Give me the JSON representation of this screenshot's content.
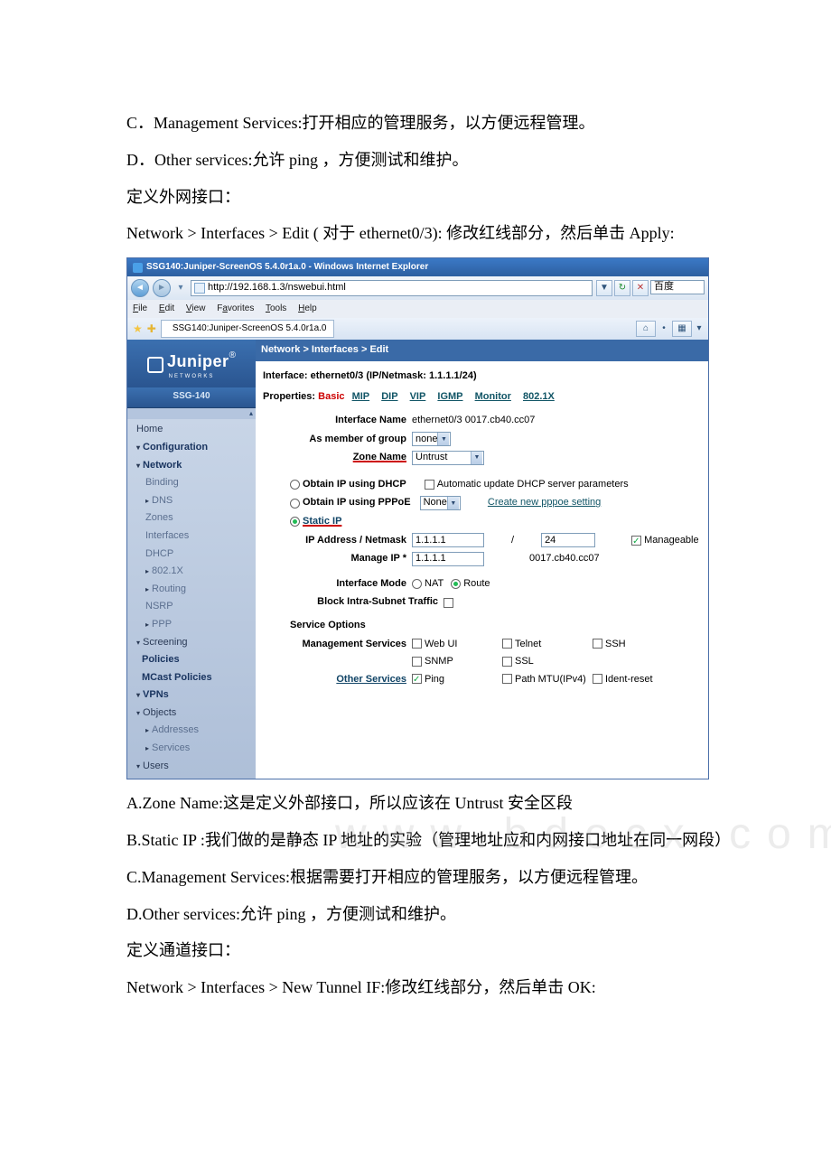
{
  "doc": {
    "pC": "C．Management Services:打开相应的管理服务，以方便远程管理。",
    "pD": "D．Other services:允许 ping ，方便测试和维护。",
    "p3": "定义外网接口：",
    "p4": "Network > Interfaces > Edit ( 对于 ethernet0/3): 修改红线部分，然后单击 Apply:",
    "pA2": "A.Zone Name:这是定义外部接口，所以应该在 Untrust 安全区段",
    "pB2": "B.Static IP :我们做的是静态 IP 地址的实验（管理地址应和内网接口地址在同一网段）",
    "pC2": "C.Management Services:根据需要打开相应的管理服务，以方便远程管理。",
    "pD2": "D.Other services:允许 ping ，方便测试和维护。",
    "p5": "定义通道接口：",
    "p6": "Network > Interfaces > New Tunnel IF:修改红线部分，然后单击 OK:"
  },
  "browser": {
    "title": "SSG140:Juniper-ScreenOS 5.4.0r1a.0 - Windows Internet Explorer",
    "url": "http://192.168.1.3/nswebui.html",
    "search": "百度",
    "menu": {
      "file": "File",
      "edit": "Edit",
      "view": "View",
      "fav": "Favorites",
      "tools": "Tools",
      "help": "Help"
    },
    "tab": "SSG140:Juniper-ScreenOS 5.4.0r1a.0"
  },
  "sidebar": {
    "breadcrumb": "Network > Interfaces > Edit",
    "logo": "Juniper",
    "logosub": "NETWORKS",
    "model": "SSG-140",
    "items": [
      "Home",
      "Configuration",
      "Network",
      "Binding",
      "DNS",
      "Zones",
      "Interfaces",
      "DHCP",
      "802.1X",
      "Routing",
      "NSRP",
      "PPP",
      "Screening",
      "Policies",
      "MCast Policies",
      "VPNs",
      "Objects",
      "Addresses",
      "Services",
      "Users"
    ]
  },
  "form": {
    "ifaceLine": "Interface: ethernet0/3 (IP/Netmask: 1.1.1.1/24)",
    "propsLabel": "Properties:",
    "basic": "Basic",
    "tabs": [
      "MIP",
      "DIP",
      "VIP",
      "IGMP",
      "Monitor",
      "802.1X"
    ],
    "ifn_label": "Interface Name",
    "ifn_value": "ethernet0/3 0017.cb40.cc07",
    "grp_label": "As member of group",
    "grp_value": "none",
    "zone_label": "Zone Name",
    "zone_value": "Untrust",
    "dhcp": "Obtain IP using DHCP",
    "autoserv": "Automatic update DHCP server parameters",
    "pppoe": "Obtain IP using PPPoE",
    "pppoe_sel": "None",
    "pppoe_link": "Create new pppoe setting",
    "static": "Static IP",
    "ipnm_label": "IP Address / Netmask",
    "ip": "1.1.1.1",
    "mask": "24",
    "sep": "/",
    "manageable": "Manageable",
    "mip_label": "Manage IP *",
    "mip": "1.1.1.1",
    "mac": "0017.cb40.cc07",
    "mode_label": "Interface Mode",
    "nat": "NAT",
    "route": "Route",
    "bist_label": "Block Intra-Subnet Traffic",
    "svc_h": "Service Options",
    "mgmt_label": "Management Services",
    "mgmt": [
      "Web UI",
      "SNMP",
      "Telnet",
      "SSL",
      "SSH"
    ],
    "other_label": "Other Services",
    "ping": "Ping",
    "pmtu": "Path MTU(IPv4)",
    "idr": "Ident-reset"
  },
  "watermark": "www.bdocx.com"
}
